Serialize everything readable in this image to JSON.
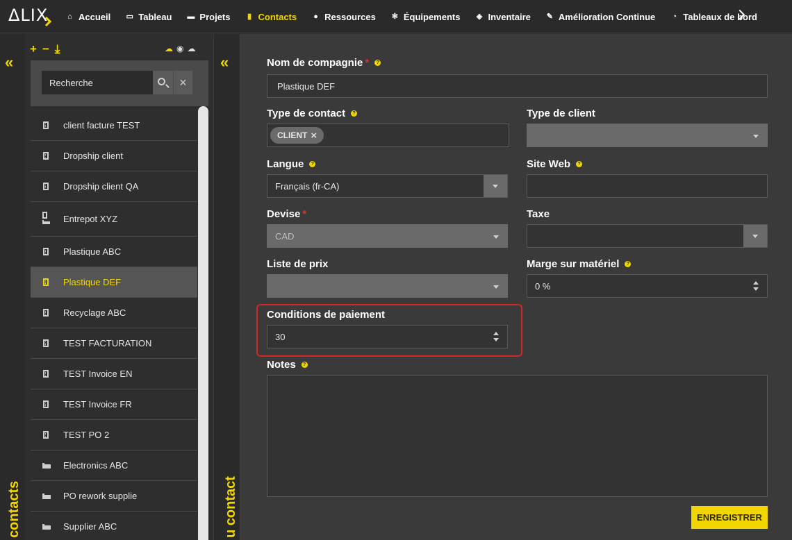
{
  "app": {
    "logo": "ΔLIX"
  },
  "nav": {
    "items": [
      {
        "label": "Accueil",
        "icon": "home-icon",
        "glyph": "⌂"
      },
      {
        "label": "Tableau",
        "icon": "monitor-icon",
        "glyph": "▭"
      },
      {
        "label": "Projets",
        "icon": "folder-icon",
        "glyph": "▬"
      },
      {
        "label": "Contacts",
        "icon": "contact-icon",
        "glyph": "▮",
        "active": true
      },
      {
        "label": "Ressources",
        "icon": "users-icon",
        "glyph": "●"
      },
      {
        "label": "Équipements",
        "icon": "gears-icon",
        "glyph": "✻"
      },
      {
        "label": "Inventaire",
        "icon": "cubes-icon",
        "glyph": "◈"
      },
      {
        "label": "Amélioration Continue",
        "icon": "magic-wand-icon",
        "glyph": "✎"
      },
      {
        "label": "Tableaux de bord",
        "icon": "gauge-icon",
        "glyph": "◔"
      }
    ],
    "accent": "#f2d600"
  },
  "left_strip": {
    "title": "contacts"
  },
  "right_strip": {
    "title": "u contact"
  },
  "list": {
    "search_placeholder": "Recherche",
    "items": [
      {
        "label": "client facture TEST",
        "icon": "building-icon"
      },
      {
        "label": "Dropship client",
        "icon": "building-icon"
      },
      {
        "label": "Dropship client QA",
        "icon": "building-icon"
      },
      {
        "label": "Entrepot XYZ",
        "icon": "building-factory-icon"
      },
      {
        "label": "Plastique ABC",
        "icon": "building-icon"
      },
      {
        "label": "Plastique DEF",
        "icon": "building-icon",
        "selected": true
      },
      {
        "label": "Recyclage ABC",
        "icon": "building-icon"
      },
      {
        "label": "TEST FACTURATION",
        "icon": "building-icon"
      },
      {
        "label": "TEST Invoice EN",
        "icon": "building-icon"
      },
      {
        "label": "TEST Invoice FR",
        "icon": "building-icon"
      },
      {
        "label": "TEST PO 2",
        "icon": "building-icon"
      },
      {
        "label": "Electronics ABC",
        "icon": "factory-icon"
      },
      {
        "label": "PO rework supplie",
        "icon": "factory-icon"
      },
      {
        "label": "Supplier ABC",
        "icon": "factory-icon"
      }
    ]
  },
  "form": {
    "company_name": {
      "label": "Nom de compagnie",
      "value": "Plastique DEF"
    },
    "contact_type": {
      "label": "Type de contact",
      "chip": "CLIENT"
    },
    "client_type": {
      "label": "Type de client",
      "value": ""
    },
    "language": {
      "label": "Langue",
      "value": "Français (fr-CA)"
    },
    "website": {
      "label": "Site Web",
      "value": ""
    },
    "currency": {
      "label": "Devise",
      "value": "CAD"
    },
    "tax": {
      "label": "Taxe",
      "value": ""
    },
    "price_list": {
      "label": "Liste de prix",
      "value": ""
    },
    "material_margin": {
      "label": "Marge sur matériel",
      "value": "0 %"
    },
    "payment_terms": {
      "label": "Conditions de paiement",
      "value": "30"
    },
    "notes": {
      "label": "Notes",
      "value": ""
    },
    "save_label": "ENREGISTRER"
  }
}
